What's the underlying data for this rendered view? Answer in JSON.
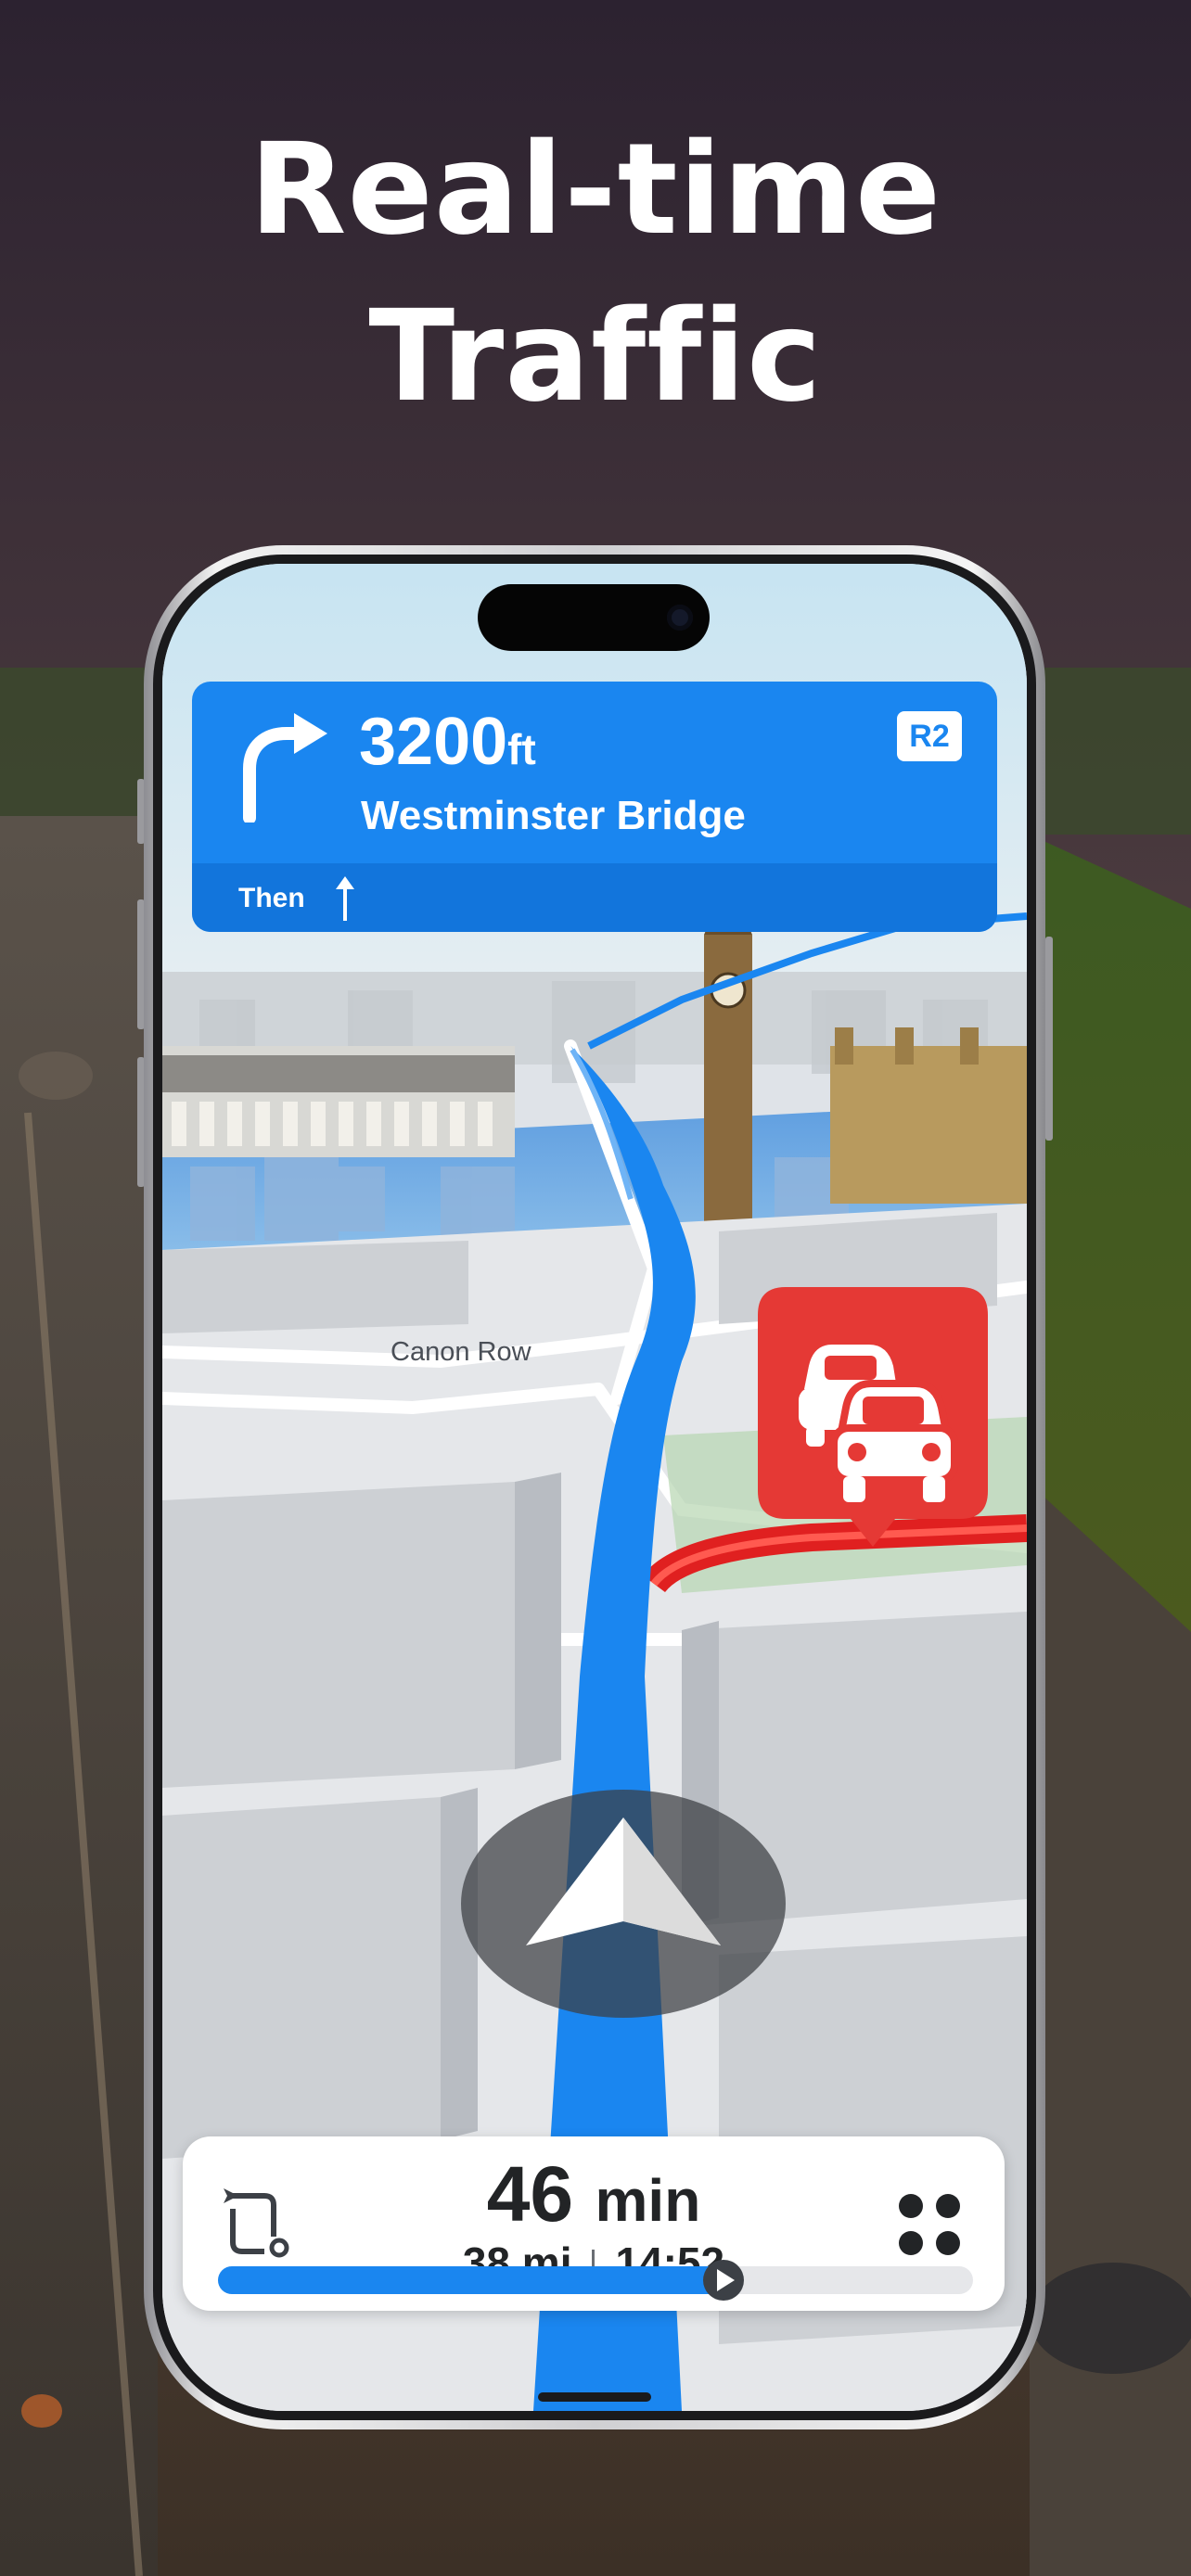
{
  "headline": {
    "line1": "Real-time",
    "line2": "Traffic"
  },
  "navigation": {
    "distance_value": "3200",
    "distance_unit": "ft",
    "street": "Westminster Bridge",
    "road_badge": "R2",
    "then_label": "Then",
    "turn_icon": "turn-right-arrow",
    "then_icon": "straight-arrow"
  },
  "map": {
    "street_label": "Canon Row",
    "traffic_icon": "traffic-jam-cars",
    "position_icon": "navigation-arrow"
  },
  "trip": {
    "duration_value": "46",
    "duration_unit": "min",
    "distance": "38 mi",
    "arrival_time": "14:52",
    "route_icon": "route-options",
    "menu_icon": "four-dots-menu",
    "progress_fraction": 0.67
  },
  "colors": {
    "route_blue": "#1a86f0",
    "traffic_red": "#e53935",
    "panel_white": "#ffffff"
  }
}
